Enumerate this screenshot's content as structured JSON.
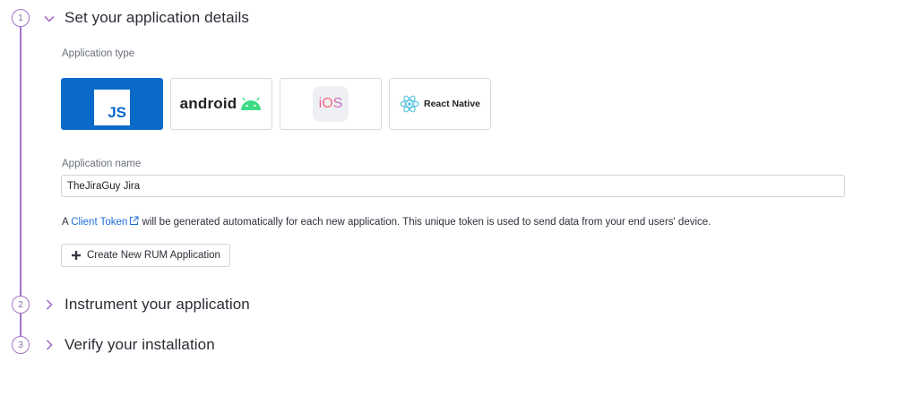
{
  "steps": [
    {
      "number": "1",
      "title": "Set your application details",
      "expanded": true
    },
    {
      "number": "2",
      "title": "Instrument your application",
      "expanded": false
    },
    {
      "number": "3",
      "title": "Verify your installation",
      "expanded": false
    }
  ],
  "application_type": {
    "label": "Application type",
    "selected": "JS",
    "options": [
      {
        "id": "js",
        "text": "JS"
      },
      {
        "id": "android",
        "text": "android"
      },
      {
        "id": "ios",
        "text": "iOS"
      },
      {
        "id": "react-native",
        "text": "React Native"
      }
    ]
  },
  "application_name": {
    "label": "Application name",
    "value": "TheJiraGuy Jira"
  },
  "info": {
    "prefix": "A ",
    "link_text": "Client Token",
    "suffix": " will be generated automatically for each new application. This unique token is used to send data from your end users' device."
  },
  "create_button": {
    "label": "Create New RUM Application"
  },
  "colors": {
    "accent_purple": "#a473c9",
    "selected_blue": "#0b6ac8",
    "link_blue": "#1e6dd4",
    "android_green": "#3ddc84"
  },
  "icons": [
    "chevron-down-icon",
    "chevron-right-icon",
    "android-robot-icon",
    "react-atom-icon",
    "external-link-icon",
    "plus-icon"
  ]
}
